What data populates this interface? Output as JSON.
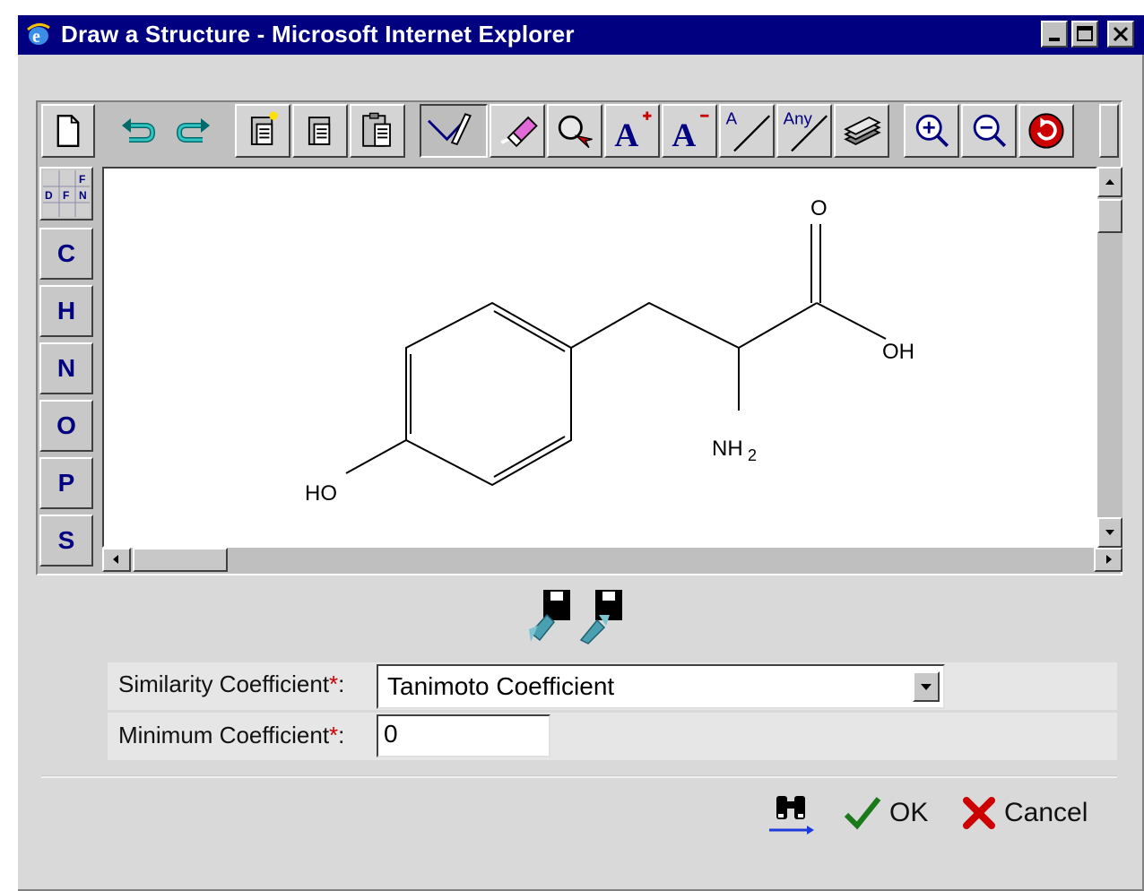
{
  "window": {
    "title": "Draw a Structure - Microsoft Internet Explorer",
    "controls": [
      "minimize-icon",
      "maximize-icon",
      "close-icon"
    ]
  },
  "toolbar": {
    "tools": [
      {
        "name": "new-document-icon"
      },
      {
        "name": "undo-icon"
      },
      {
        "name": "redo-icon"
      },
      {
        "name": "new-copy-icon"
      },
      {
        "name": "copy-icon"
      },
      {
        "name": "paste-icon"
      },
      {
        "name": "draw-bond-icon"
      },
      {
        "name": "eraser-icon"
      },
      {
        "name": "select-query-icon"
      },
      {
        "name": "increase-charge-icon"
      },
      {
        "name": "decrease-charge-icon"
      },
      {
        "name": "atom-label-tool-icon",
        "text": "A"
      },
      {
        "name": "any-atom-tool-icon",
        "text": "Any"
      },
      {
        "name": "templates-icon"
      },
      {
        "name": "zoom-in-icon"
      },
      {
        "name": "zoom-out-icon"
      },
      {
        "name": "refresh-icon"
      }
    ]
  },
  "periodic_table_button": {
    "cells": [
      "",
      "",
      "F",
      "D",
      "F",
      "N",
      "",
      "",
      ""
    ]
  },
  "atoms": [
    "C",
    "H",
    "N",
    "O",
    "P",
    "S"
  ],
  "molecule": {
    "labels": {
      "oxygen": "O",
      "hydroxyl": "OH",
      "amine": "NH",
      "amine_sub": "2",
      "phenol": "HO"
    }
  },
  "form": {
    "similarity_label": "Similarity Coefficient",
    "minimum_label": "Minimum Coefficient",
    "required_mark": "*",
    "colon": ":",
    "similarity_value": "Tanimoto Coefficient",
    "minimum_value": "0"
  },
  "actions": {
    "search_icon": "binoculars-icon",
    "ok_label": "OK",
    "cancel_label": "Cancel"
  },
  "colors": {
    "title_bar": "#000080",
    "ok_check": "#1a7a1a",
    "cancel_x": "#cc0000",
    "atom_text": "#000080"
  }
}
